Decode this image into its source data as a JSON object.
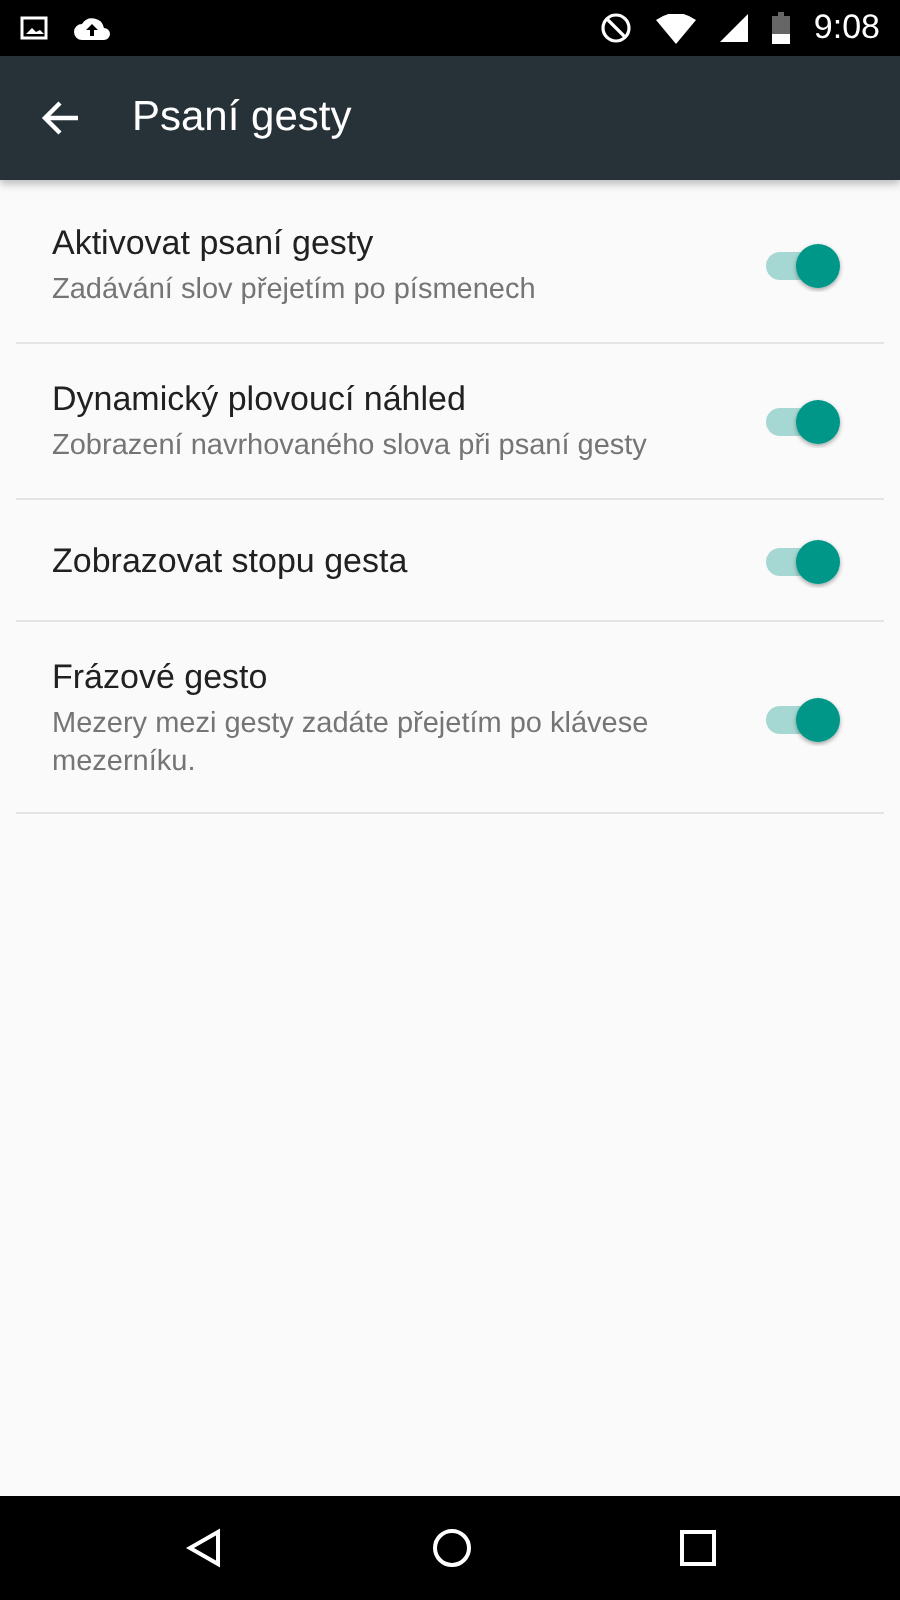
{
  "status_bar": {
    "time": "9:08"
  },
  "toolbar": {
    "title": "Psaní gesty"
  },
  "settings": [
    {
      "title": "Aktivovat psaní gesty",
      "summary": "Zadávání slov přejetím po písmenech",
      "on": true
    },
    {
      "title": "Dynamický plovoucí náhled",
      "summary": "Zobrazení navrhovaného slova při psaní gesty",
      "on": true
    },
    {
      "title": "Zobrazovat stopu gesta",
      "on": true
    },
    {
      "title": "Frázové gesto",
      "summary": "Mezery mezi gesty zadáte přejetím po klávese mezerníku.",
      "on": true
    }
  ]
}
